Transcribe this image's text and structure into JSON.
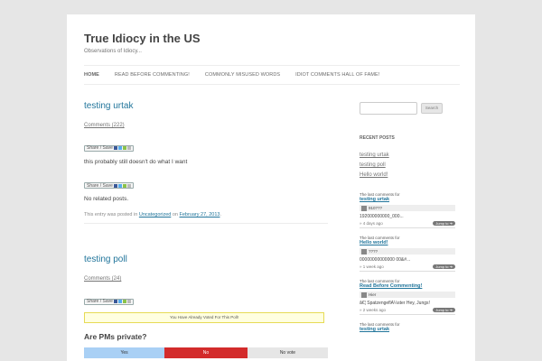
{
  "site": {
    "title": "True Idiocy in the US",
    "description": "Observations of Idiocy..."
  },
  "nav": {
    "items": [
      {
        "label": "HOME",
        "active": true
      },
      {
        "label": "READ BEFORE COMMENTING!",
        "active": false
      },
      {
        "label": "COMMONLY MISUSED WORDS",
        "active": false
      },
      {
        "label": "IDIOT COMMENTS HALL OF FAME!",
        "active": false
      }
    ]
  },
  "posts": [
    {
      "title": "testing urtak",
      "comments": "Comments (222)",
      "share_label": "Share / Save",
      "body": "this probably still doesn't do what I want",
      "related": "No related posts.",
      "meta_prefix": "This entry was posted in ",
      "category": "Uncategorized",
      "meta_on": " on ",
      "date": "February 27, 2013",
      "meta_end": "."
    },
    {
      "title": "testing poll",
      "comments": "Comments (24)",
      "share_label": "Share / Save",
      "voted_notice": "You Have Already Voted For This Poll!",
      "poll_question": "Are PMs private?",
      "poll_options": [
        {
          "label": "Yes",
          "fraction": 0.33,
          "color": "#a9d0f5",
          "text_color": "#333333"
        },
        {
          "label": "No",
          "fraction": 0.34,
          "color": "#d32b2b",
          "text_color": "#ffffff"
        },
        {
          "label": "No vote",
          "fraction": 0.33,
          "color": "#e6e6e6",
          "text_color": "#333333"
        }
      ]
    }
  ],
  "sidebar": {
    "search_button": "Search",
    "recent_posts_title": "RECENT POSTS",
    "recent_posts": [
      "testing urtak",
      "testing poll",
      "Hello world!"
    ],
    "last_comments": [
      {
        "head": "The last comments for",
        "post": "testing urtak",
        "author": "910???",
        "excerpt": "192000000000_000...",
        "time": "» 4 days ago",
        "jump": "Jump to ➔"
      },
      {
        "head": "The last comments for",
        "post": "Hello world!",
        "author": "????",
        "excerpt": "00000000000000 00&#...",
        "time": "» 1 week ago",
        "jump": "Jump to ➔"
      },
      {
        "head": "The last comments for",
        "post": "Read Before Commenting!",
        "author": "Hier",
        "excerpt": "â€¦ SpatzengeflÃ¼ster Hey, Jungs!",
        "time": "» 2 weeks ago",
        "jump": "Jump to ➔"
      },
      {
        "head": "The last comments for",
        "post": "testing urtak",
        "author": "",
        "excerpt": "",
        "time": "",
        "jump": ""
      }
    ]
  },
  "colors": {
    "link": "#21759b",
    "poll_yes": "#a9d0f5",
    "poll_no": "#d32b2b",
    "poll_novote": "#e6e6e6",
    "notice_bg": "#ffffe0"
  }
}
